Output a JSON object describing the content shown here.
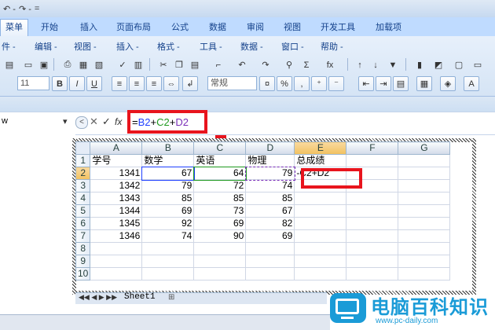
{
  "qat": {
    "undo": "↶ -",
    "redo": "↷ -",
    "more": "="
  },
  "tabs": [
    "菜单",
    "开始",
    "插入",
    "页面布局",
    "公式",
    "数据",
    "审阅",
    "视图",
    "开发工具",
    "加载项"
  ],
  "menus": [
    "件 -",
    "编辑 -",
    "视图 -",
    "插入 -",
    "格式 -",
    "工具 -",
    "数据 -",
    "窗口 -",
    "帮助 -"
  ],
  "toolbar": {
    "font_size": "11",
    "bold": "B",
    "italic": "I",
    "underline": "U",
    "number_format": "常规",
    "percent": "%",
    "sum": "Σ",
    "fx": "fx"
  },
  "formula_bar": {
    "name_box": "w",
    "cancel": "✕",
    "enter": "✓",
    "fx": "fx",
    "formula_parts": [
      {
        "text": "=",
        "color": "#000000"
      },
      {
        "text": "B2",
        "color": "#1f3fff"
      },
      {
        "text": "+",
        "color": "#000000"
      },
      {
        "text": "C2",
        "color": "#1f9a1f"
      },
      {
        "text": "+",
        "color": "#000000"
      },
      {
        "text": "D2",
        "color": "#7a2fb8"
      }
    ]
  },
  "sheet": {
    "columns": [
      "A",
      "B",
      "C",
      "D",
      "E",
      "F",
      "G"
    ],
    "rows": [
      {
        "n": "1",
        "cells": [
          "学号",
          "数学",
          "英语",
          "物理",
          "总成绩",
          "",
          ""
        ]
      },
      {
        "n": "2",
        "cells": [
          "1341",
          "67",
          "64",
          "79",
          "-C2+D2",
          "",
          ""
        ]
      },
      {
        "n": "3",
        "cells": [
          "1342",
          "79",
          "72",
          "74",
          "",
          "",
          ""
        ]
      },
      {
        "n": "4",
        "cells": [
          "1343",
          "85",
          "85",
          "85",
          "",
          "",
          ""
        ]
      },
      {
        "n": "5",
        "cells": [
          "1344",
          "69",
          "73",
          "67",
          "",
          "",
          ""
        ]
      },
      {
        "n": "6",
        "cells": [
          "1345",
          "92",
          "69",
          "82",
          "",
          "",
          ""
        ]
      },
      {
        "n": "7",
        "cells": [
          "1346",
          "74",
          "90",
          "69",
          "",
          "",
          ""
        ]
      },
      {
        "n": "8",
        "cells": [
          "",
          "",
          "",
          "",
          "",
          "",
          ""
        ]
      },
      {
        "n": "9",
        "cells": [
          "",
          "",
          "",
          "",
          "",
          "",
          ""
        ]
      },
      {
        "n": "10",
        "cells": [
          "",
          "",
          "",
          "",
          "",
          "",
          ""
        ]
      }
    ],
    "sheet_tab": "Sheet1"
  },
  "watermark": {
    "brand": "电脑百科知识",
    "url": "www.pc-daily.com"
  },
  "colors": {
    "highlight": "#e8141d",
    "ribbon": "#bfdbff"
  }
}
